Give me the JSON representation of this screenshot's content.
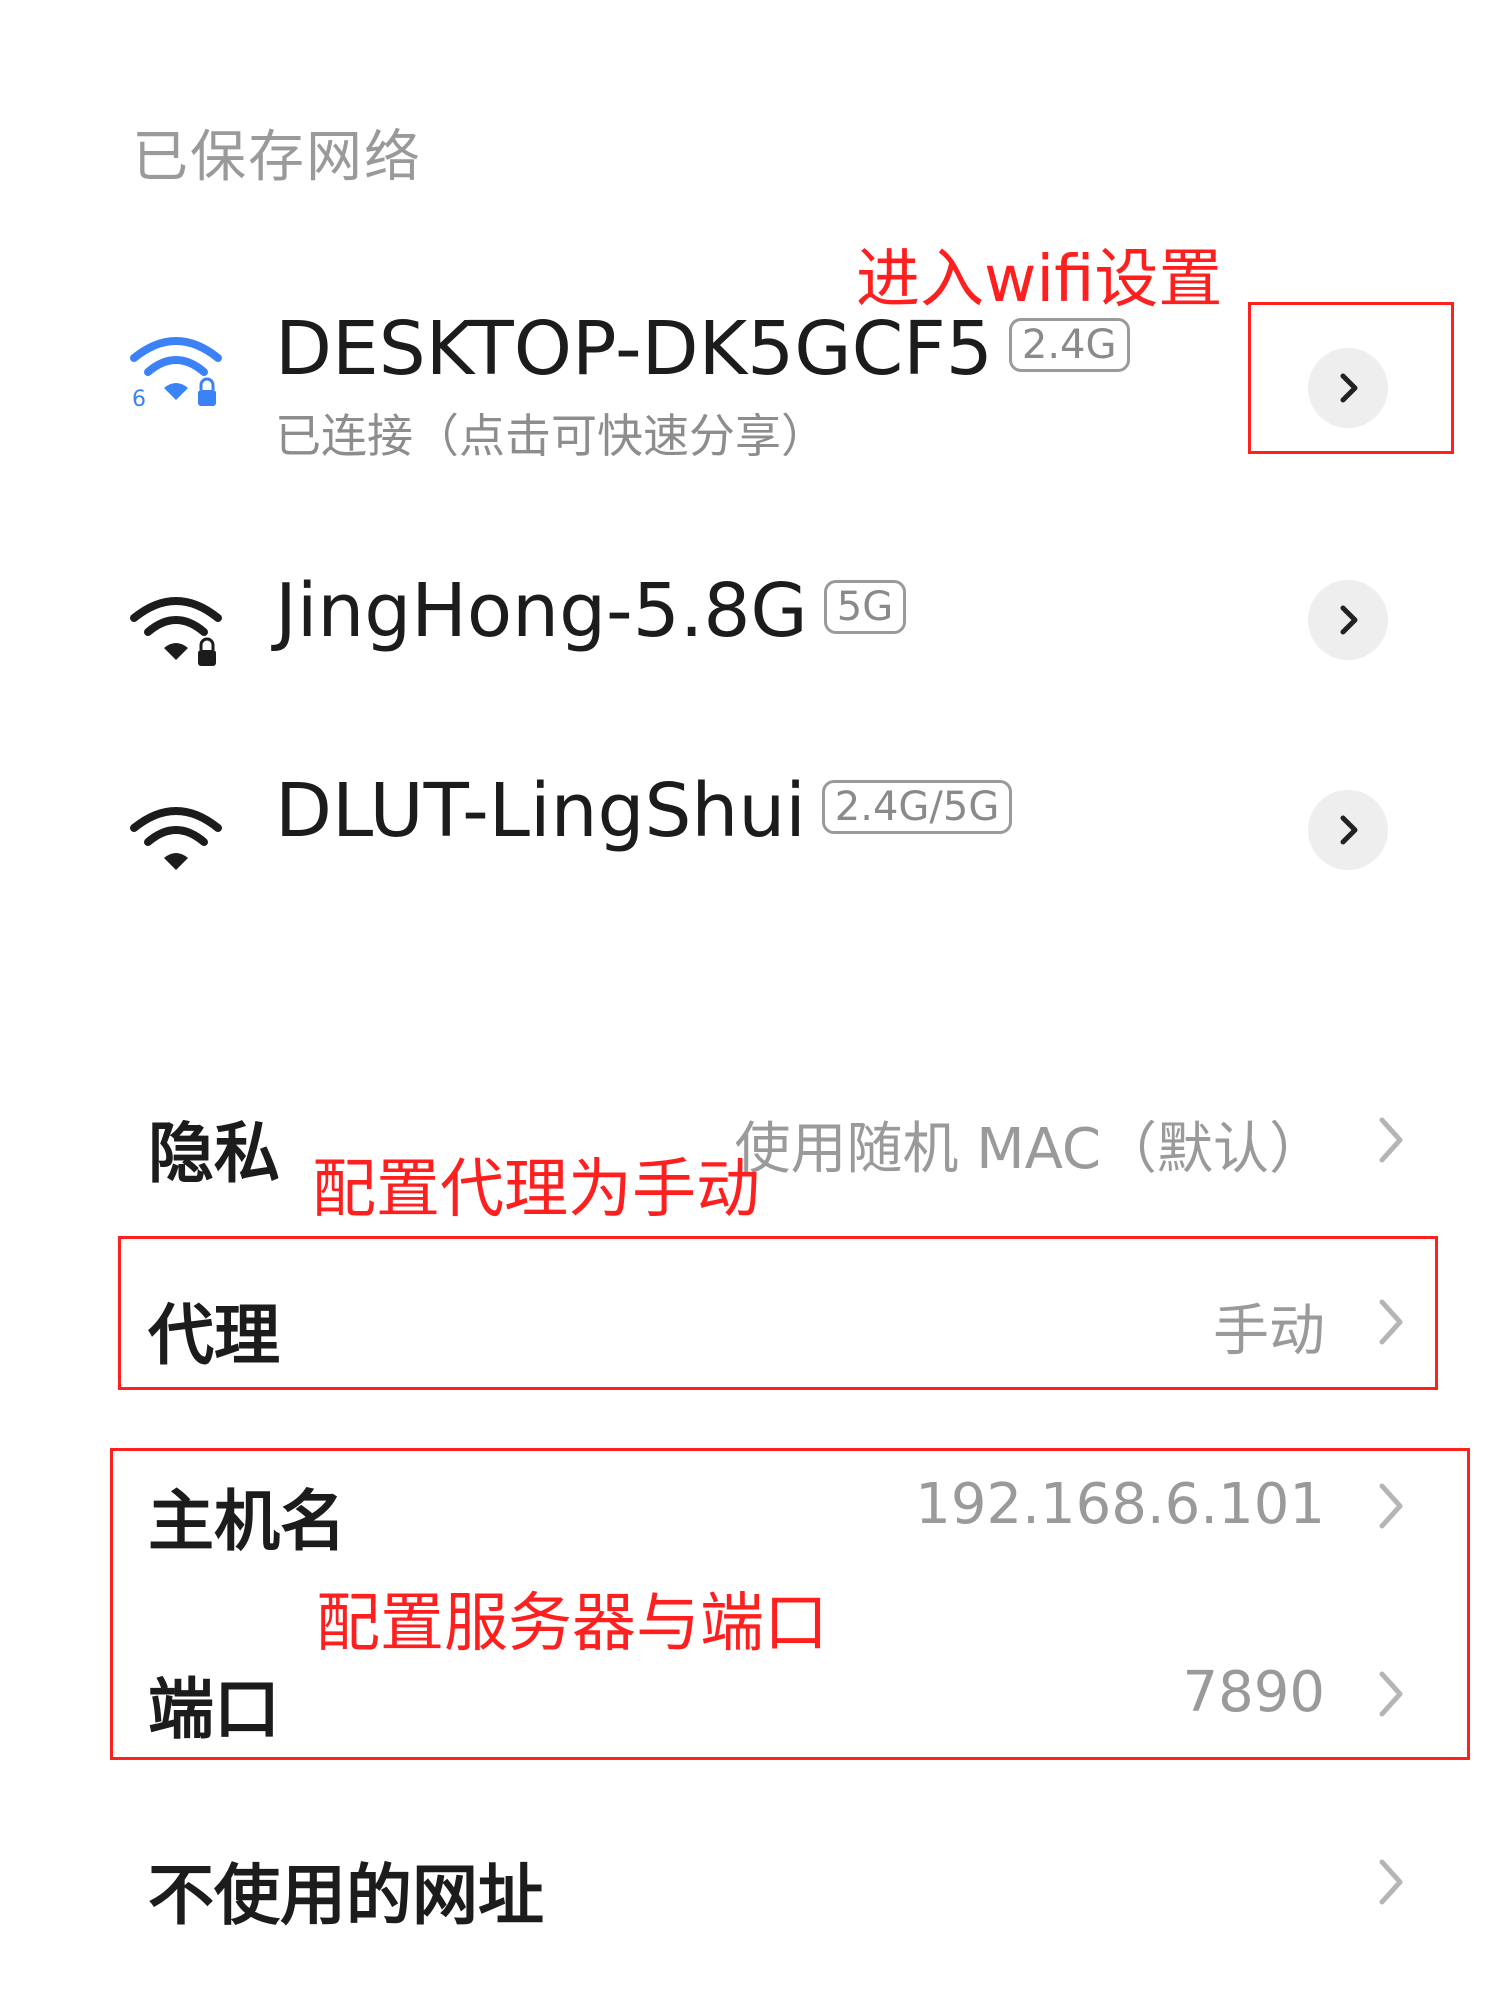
{
  "section_title": "已保存网络",
  "networks": [
    {
      "name": "DESKTOP-DK5GCF5",
      "band": "2.4G",
      "status": "已连接（点击可快速分享）",
      "wifi_icon": "wifi-6-lock-icon-connected",
      "wifi_standard_label": "6",
      "connected_color": "#3b82f6"
    },
    {
      "name": "JingHong-5.8G",
      "band": "5G",
      "wifi_icon": "wifi-lock-icon"
    },
    {
      "name": "DLUT-LingShui",
      "band": "2.4G/5G",
      "wifi_icon": "wifi-icon"
    }
  ],
  "settings": {
    "privacy": {
      "label": "隐私",
      "value": "使用随机 MAC（默认）"
    },
    "proxy": {
      "label": "代理",
      "value": "手动"
    },
    "hostname": {
      "label": "主机名",
      "value": "192.168.6.101"
    },
    "port": {
      "label": "端口",
      "value": "7890"
    },
    "bypass": {
      "label": "不使用的网址",
      "value": ""
    }
  },
  "annotations": {
    "enter_wifi": "进入wifi设置",
    "proxy_manual": "配置代理为手动",
    "server_port": "配置服务器与端口",
    "color": "#ff1f1f"
  }
}
